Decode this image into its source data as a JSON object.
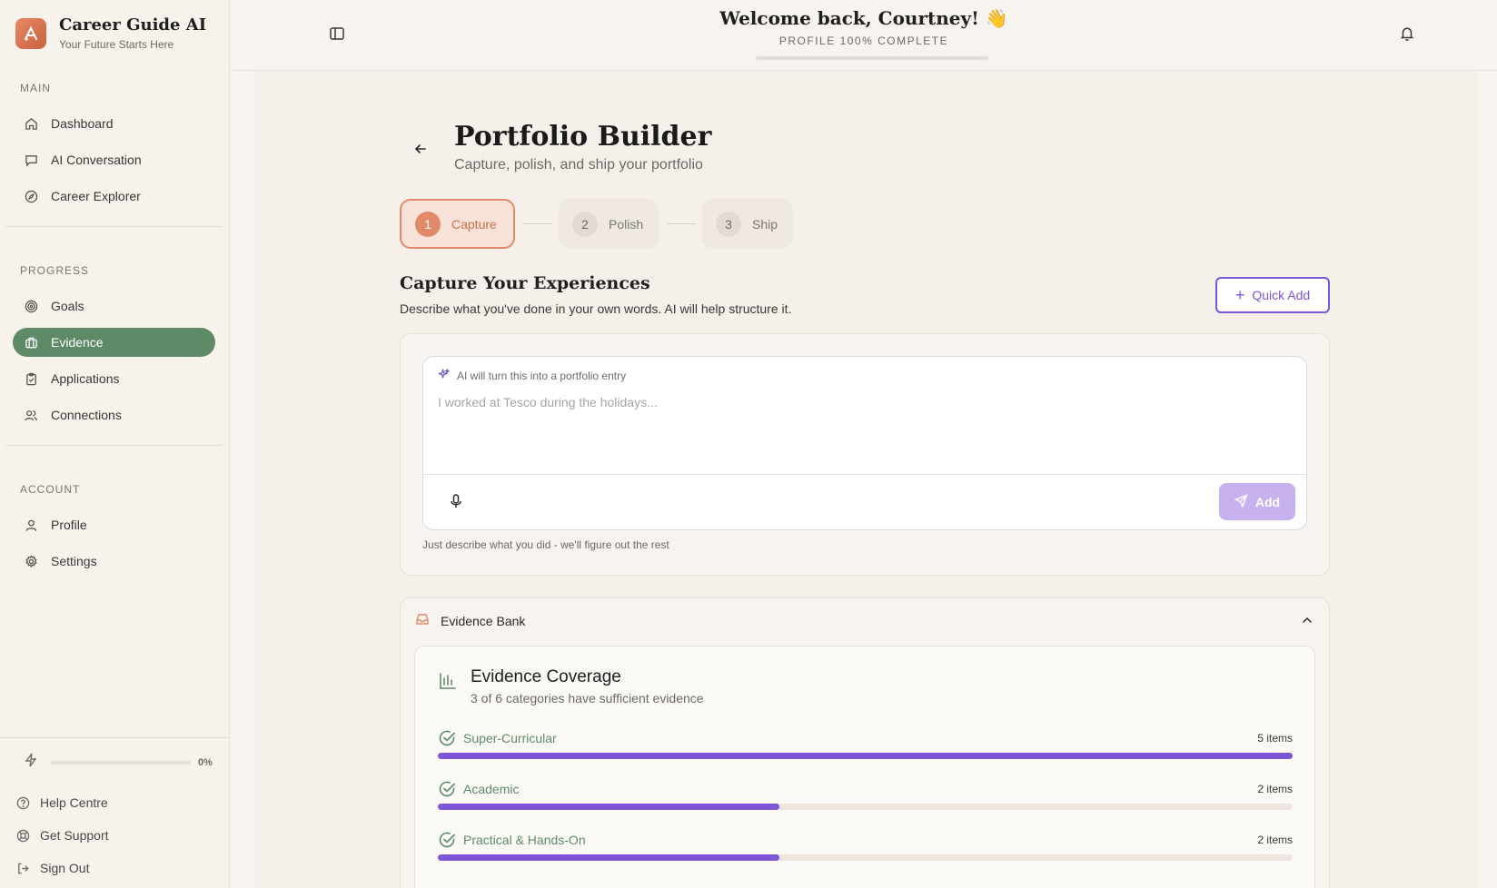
{
  "brand": {
    "title": "Career Guide AI",
    "subtitle": "Your Future Starts Here"
  },
  "sidebar": {
    "main_label": "MAIN",
    "main_items": [
      {
        "label": "Dashboard",
        "icon": "home-icon"
      },
      {
        "label": "AI Conversation",
        "icon": "chat-icon"
      },
      {
        "label": "Career Explorer",
        "icon": "compass-icon"
      }
    ],
    "progress_label": "PROGRESS",
    "progress_items": [
      {
        "label": "Goals",
        "icon": "target-icon"
      },
      {
        "label": "Evidence",
        "icon": "briefcase-icon",
        "active": true
      },
      {
        "label": "Applications",
        "icon": "clipboard-icon"
      },
      {
        "label": "Connections",
        "icon": "users-icon"
      }
    ],
    "account_label": "ACCOUNT",
    "account_items": [
      {
        "label": "Profile",
        "icon": "user-icon"
      },
      {
        "label": "Settings",
        "icon": "gear-icon"
      }
    ],
    "energy_percent": "0%",
    "energy_value": 0,
    "footer_items": [
      {
        "label": "Help Centre",
        "icon": "help-icon"
      },
      {
        "label": "Get Support",
        "icon": "lifebuoy-icon"
      },
      {
        "label": "Sign Out",
        "icon": "sign-out-icon"
      }
    ]
  },
  "header": {
    "welcome": "Welcome back, Courtney! 👋",
    "profile_complete": "PROFILE 100% COMPLETE",
    "profile_progress": 1.0
  },
  "page": {
    "title": "Portfolio Builder",
    "subtitle": "Capture, polish, and ship your portfolio",
    "steps": [
      {
        "num": "1",
        "label": "Capture",
        "active": true
      },
      {
        "num": "2",
        "label": "Polish"
      },
      {
        "num": "3",
        "label": "Ship"
      }
    ]
  },
  "capture": {
    "title": "Capture Your Experiences",
    "description": "Describe what you've done in your own words. AI will help structure it.",
    "quick_add_label": "Quick Add",
    "ai_hint": "AI will turn this into a portfolio entry",
    "placeholder": "I worked at Tesco during the holidays...",
    "add_label": "Add",
    "help_text": "Just describe what you did - we'll figure out the rest"
  },
  "evidence_bank": {
    "title": "Evidence Bank",
    "coverage": {
      "title": "Evidence Coverage",
      "subtitle": "3 of 6 categories have sufficient evidence",
      "categories": [
        {
          "name": "Super-Curricular",
          "count": "5 items",
          "progress": 1.0
        },
        {
          "name": "Academic",
          "count": "2 items",
          "progress": 0.4
        },
        {
          "name": "Practical & Hands-On",
          "count": "2 items",
          "progress": 0.4
        }
      ]
    }
  },
  "colors": {
    "accent": "#7d55d6",
    "brand": "#e08a6a",
    "active_nav": "#5f8a68"
  }
}
